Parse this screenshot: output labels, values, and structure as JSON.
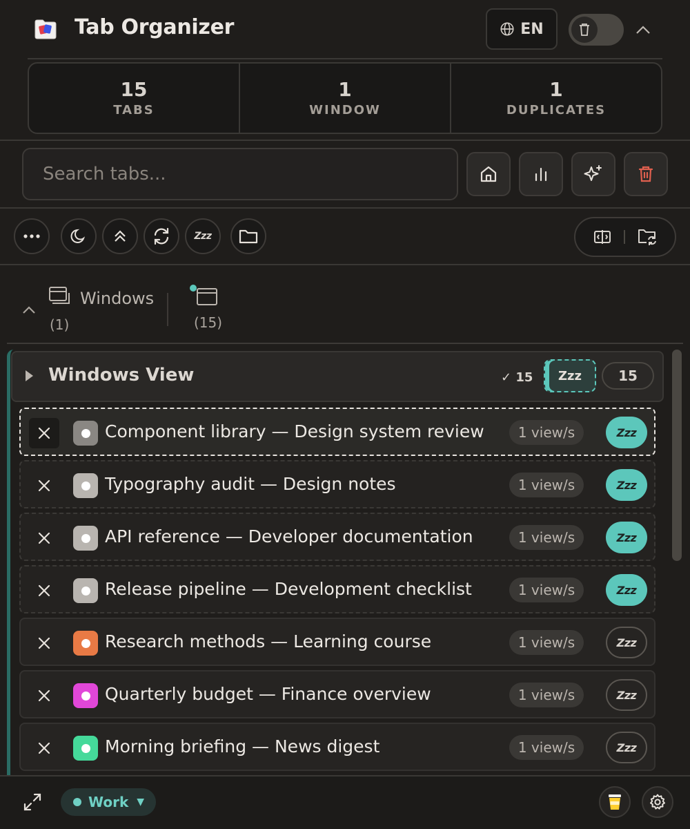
{
  "header": {
    "title": "Tab Organizer",
    "lang_label": "EN",
    "logo_icon": "tab-organizer-logo",
    "toggle_icon": "trash-icon"
  },
  "stats": [
    {
      "value": "15",
      "label": "TABS"
    },
    {
      "value": "1",
      "label": "WINDOW"
    },
    {
      "value": "1",
      "label": "DUPLICATES"
    }
  ],
  "search": {
    "placeholder": "Search tabs...",
    "value": ""
  },
  "toolbar": {
    "actions": [
      "home-icon",
      "chart-icon",
      "sparkle-icon",
      "trash-icon"
    ],
    "tools": [
      "more-icon",
      "moon-icon",
      "collapse-up-icon",
      "refresh-icon",
      "sleep-icon",
      "folder-icon"
    ],
    "sleep_label": "Zzz",
    "view_switch": [
      "split-view-icon",
      "folder-sync-icon"
    ]
  },
  "windows": {
    "label": "Windows",
    "window_count": "(1)",
    "tab_count": "(15)"
  },
  "windows_view": {
    "title": "Windows View",
    "checked": "✓ 15",
    "sleep_label": "Zzz",
    "total": "15"
  },
  "tabs": [
    {
      "title": "Component library — Design system review",
      "views": "1 view/s",
      "sleep": "Zzz",
      "color": "#8a8783"
    },
    {
      "title": "Typography audit — Design notes",
      "views": "1 view/s",
      "sleep": "Zzz",
      "color": "#b9b5b0"
    },
    {
      "title": "API reference — Developer documentation",
      "views": "1 view/s",
      "sleep": "Zzz",
      "color": "#b9b5b0"
    },
    {
      "title": "Release pipeline — Development checklist",
      "views": "1 view/s",
      "sleep": "Zzz",
      "color": "#b9b5b0"
    },
    {
      "title": "Research methods — Learning course",
      "views": "1 view/s",
      "sleep": "Zzz",
      "color": "#e87a45"
    },
    {
      "title": "Quarterly budget — Finance overview",
      "views": "1 view/s",
      "sleep": "Zzz",
      "color": "#e147d8"
    },
    {
      "title": "Morning briefing — News digest",
      "views": "1 view/s",
      "sleep": "Zzz",
      "color": "#45d99a"
    }
  ],
  "footer": {
    "workspace": "Work",
    "workspace_color": "#6fd0c4",
    "icons": [
      "expand-icon",
      "coffee-icon",
      "settings-icon"
    ]
  },
  "colors": {
    "accent": "#5cc7bb",
    "background": "#1f1d1b"
  }
}
